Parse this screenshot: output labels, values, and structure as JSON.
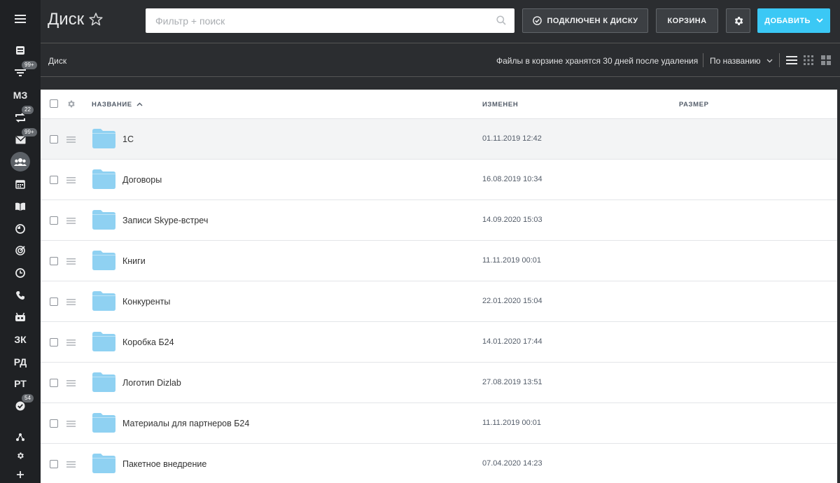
{
  "sidebar": {
    "items": [
      {
        "icon": "menu-icon"
      },
      {
        "icon": "feed-icon"
      },
      {
        "icon": "filter-icon",
        "badge": "99+"
      },
      {
        "text": "МЗ"
      },
      {
        "icon": "sync-icon",
        "badge": "22"
      },
      {
        "icon": "mail-icon",
        "badge": "99+"
      },
      {
        "icon": "group-icon",
        "active": true
      },
      {
        "icon": "calendar-icon"
      },
      {
        "icon": "book-icon"
      },
      {
        "icon": "chart-icon"
      },
      {
        "icon": "target-icon"
      },
      {
        "icon": "clock-icon"
      },
      {
        "icon": "phone-icon"
      },
      {
        "icon": "robot-icon"
      },
      {
        "text": "ЗК"
      },
      {
        "text": "РД"
      },
      {
        "text": "РТ"
      },
      {
        "icon": "check-icon",
        "badge": "54"
      },
      {
        "icon": "sitemap-icon"
      },
      {
        "icon": "settings-icon"
      },
      {
        "icon": "plus-icon"
      }
    ]
  },
  "header": {
    "title": "Диск",
    "search_placeholder": "Фильтр + поиск",
    "connect_label": "ПОДКЛЮЧЕН К ДИСКУ",
    "trash_label": "КОРЗИНА",
    "add_label": "ДОБАВИТЬ"
  },
  "toolbar": {
    "breadcrumb": "Диск",
    "trash_note": "Файлы в корзине хранятся 30 дней после удаления",
    "sort_label": "По названию"
  },
  "table": {
    "columns": {
      "name": "НАЗВАНИЕ",
      "modified": "ИЗМЕНЕН",
      "size": "РАЗМЕР"
    },
    "rows": [
      {
        "name": "1С",
        "modified": "01.11.2019 12:42"
      },
      {
        "name": "Договоры",
        "modified": "16.08.2019 10:34"
      },
      {
        "name": "Записи Skype-встреч",
        "modified": "14.09.2020 15:03"
      },
      {
        "name": "Книги",
        "modified": "11.11.2019 00:01"
      },
      {
        "name": "Конкуренты",
        "modified": "22.01.2020 15:04"
      },
      {
        "name": "Коробка Б24",
        "modified": "14.01.2020 17:44"
      },
      {
        "name": "Логотип Dizlab",
        "modified": "27.08.2019 13:51"
      },
      {
        "name": "Материалы для партнеров Б24",
        "modified": "11.11.2019 00:01"
      },
      {
        "name": "Пакетное внедрение",
        "modified": "07.04.2020 14:23"
      }
    ]
  },
  "colors": {
    "accent": "#3bc8f5",
    "folder": "#8fd1f2",
    "sidebar_bg": "#1f2124",
    "header_bg": "#2b2d30"
  }
}
